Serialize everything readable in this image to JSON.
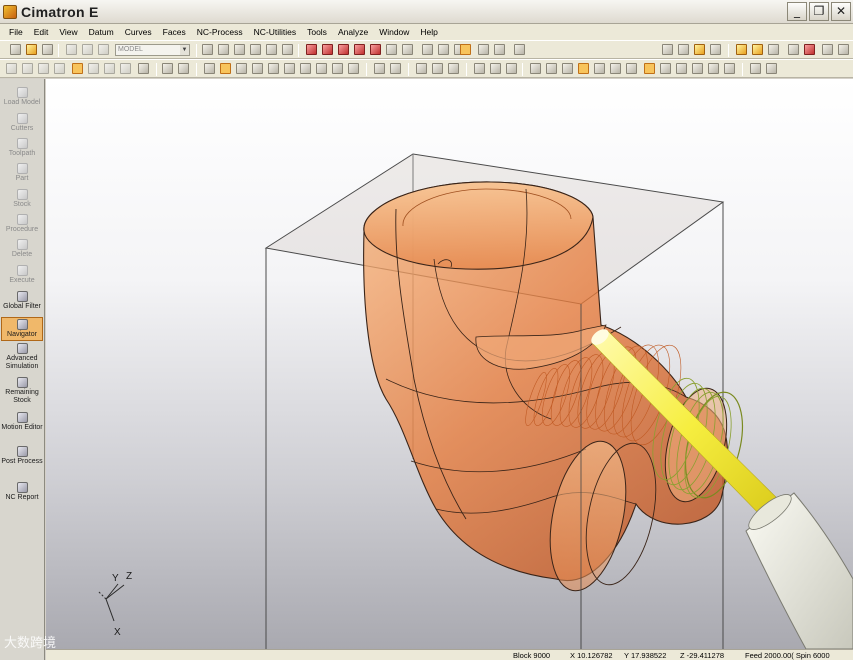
{
  "window": {
    "title": "Cimatron E",
    "buttons": {
      "minimize": "_",
      "maximize": "❐",
      "close": "✕"
    }
  },
  "menu": [
    "File",
    "Edit",
    "View",
    "Datum",
    "Curves",
    "Faces",
    "NC-Process",
    "NC-Utilities",
    "Tools",
    "Analyze",
    "Window",
    "Help"
  ],
  "toolbar": {
    "model_combo": "MODEL"
  },
  "nc_panel": [
    {
      "label": "Load Model",
      "state": "dim"
    },
    {
      "label": "Cutters",
      "state": "dim"
    },
    {
      "label": "Toolpath",
      "state": "dim"
    },
    {
      "label": "Part",
      "state": "dim"
    },
    {
      "label": "Stock",
      "state": "dim"
    },
    {
      "label": "Procedure",
      "state": "dim"
    },
    {
      "label": "Delete",
      "state": "dim"
    },
    {
      "label": "Execute",
      "state": "dim"
    },
    {
      "label": "Global Filter",
      "state": "normal"
    },
    {
      "label": "Navigator",
      "state": "active"
    },
    {
      "label": "Advanced Simulation",
      "state": "normal"
    },
    {
      "label": "Remaining Stock",
      "state": "normal"
    },
    {
      "label": "Motion Editor",
      "state": "normal"
    },
    {
      "label": "Post Process",
      "state": "normal"
    },
    {
      "label": "NC Report",
      "state": "normal"
    }
  ],
  "axes": {
    "x": "X",
    "y": "Y",
    "z": "Z"
  },
  "status": {
    "block": "Block 9000",
    "x": "X 10.126782",
    "y": "Y 17.938522",
    "z": "Z -29.411278",
    "feed": "Feed 2000.00( Spin 6000"
  },
  "watermark": "大数跨境",
  "colors": {
    "part": "#e8884a",
    "tool_beam": "#f4f04c",
    "active": "#f0b86a"
  }
}
